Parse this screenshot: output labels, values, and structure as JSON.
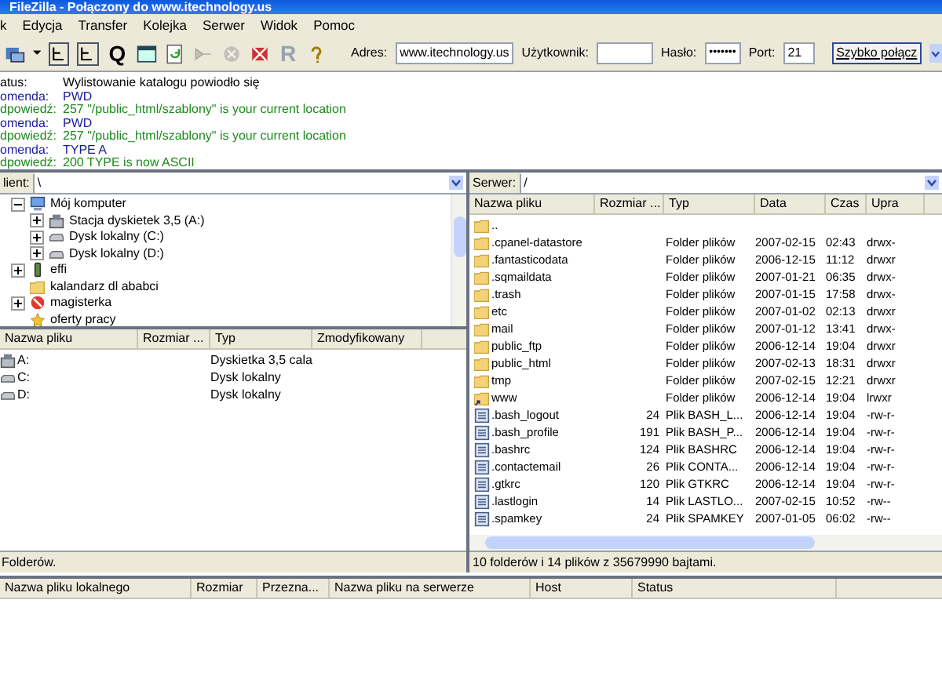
{
  "window": {
    "title": "FileZilla - Połączony do www.itechnology.us"
  },
  "menu": [
    "k",
    "Edycja",
    "Transfer",
    "Kolejka",
    "Serwer",
    "Widok",
    "Pomoc"
  ],
  "toolbar": [
    {
      "kind": "sitemanager",
      "disabled": false
    },
    {
      "kind": "dropdown",
      "disabled": false
    },
    {
      "kind": "tree",
      "disabled": false
    },
    {
      "kind": "tree",
      "disabled": false
    },
    {
      "kind": "letter",
      "glyph": "Q",
      "disabled": false
    },
    {
      "kind": "window",
      "disabled": false
    },
    {
      "kind": "refresh",
      "disabled": false
    },
    {
      "kind": "process",
      "disabled": true
    },
    {
      "kind": "cancel",
      "disabled": true
    },
    {
      "kind": "disconnect",
      "disabled": false
    },
    {
      "kind": "letter",
      "glyph": "R",
      "disabled": true
    },
    {
      "kind": "help",
      "disabled": false
    }
  ],
  "quickconnect": {
    "address_label": "Adres:",
    "address": "www.itechnology.us",
    "user_label": "Użytkownik:",
    "password_label": "Hasło:",
    "password": "•••••••",
    "port_label": "Port:",
    "port": "21",
    "button": "Szybko połącz"
  },
  "log": [
    {
      "kind": "status",
      "label": "atus:",
      "text": "Wylistowanie katalogu powiodło się"
    },
    {
      "kind": "command",
      "label": "omenda:",
      "text": "PWD"
    },
    {
      "kind": "response",
      "label": "dpowiedź:",
      "text": "257 \"/public_html/szablony\" is your current location"
    },
    {
      "kind": "command",
      "label": "omenda:",
      "text": "PWD"
    },
    {
      "kind": "response",
      "label": "dpowiedź:",
      "text": "257 \"/public_html/szablony\" is your current location"
    },
    {
      "kind": "command",
      "label": "omenda:",
      "text": "TYPE A"
    },
    {
      "kind": "response",
      "label": "dpowiedź:",
      "text": "200 TYPE is now ASCII"
    }
  ],
  "local": {
    "path_label": "lient:",
    "path": "\\",
    "tree": [
      {
        "label": "Mój komputer",
        "kind": "computer",
        "expanded": true,
        "children": [
          {
            "label": "Stacja dyskietek 3,5 (A:)",
            "kind": "floppy",
            "expanded": false
          },
          {
            "label": "Dysk lokalny (C:)",
            "kind": "drive",
            "expanded": false
          },
          {
            "label": "Dysk lokalny (D:)",
            "kind": "drive",
            "expanded": false
          }
        ]
      },
      {
        "label": "effi",
        "kind": "device",
        "expanded": false
      },
      {
        "label": "kalandarz dl ababci",
        "kind": "folder"
      },
      {
        "label": "magisterka",
        "kind": "blocked",
        "expanded": false
      },
      {
        "label": "oferty pracy",
        "kind": "star"
      }
    ],
    "columns": [
      "Nazwa pliku",
      "Rozmiar ...",
      "Typ",
      "Zmodyfikowany"
    ],
    "rows": [
      {
        "name": "A:",
        "type": "Dyskietka 3,5 cala",
        "kind": "floppy"
      },
      {
        "name": "C:",
        "type": "Dysk lokalny",
        "kind": "drive"
      },
      {
        "name": "D:",
        "type": "Dysk lokalny",
        "kind": "drive"
      }
    ],
    "status": "Folderów."
  },
  "remote": {
    "path_label": "Serwer:",
    "path": "/",
    "columns": [
      "Nazwa pliku",
      "Rozmiar ...",
      "Typ",
      "Data",
      "Czas",
      "Upra"
    ],
    "rows": [
      {
        "kind": "folder",
        "name": ".."
      },
      {
        "kind": "folder",
        "name": ".cpanel-datastore",
        "type": "Folder plików",
        "date": "2007-02-15",
        "time": "02:43",
        "perms": "drwx-"
      },
      {
        "kind": "folder",
        "name": ".fantasticodata",
        "type": "Folder plików",
        "date": "2006-12-15",
        "time": "11:12",
        "perms": "drwxr"
      },
      {
        "kind": "folder",
        "name": ".sqmaildata",
        "type": "Folder plików",
        "date": "2007-01-21",
        "time": "06:35",
        "perms": "drwx-"
      },
      {
        "kind": "folder",
        "name": ".trash",
        "type": "Folder plików",
        "date": "2007-01-15",
        "time": "17:58",
        "perms": "drwx-"
      },
      {
        "kind": "folder",
        "name": "etc",
        "type": "Folder plików",
        "date": "2007-01-02",
        "time": "02:13",
        "perms": "drwxr"
      },
      {
        "kind": "folder",
        "name": "mail",
        "type": "Folder plików",
        "date": "2007-01-12",
        "time": "13:41",
        "perms": "drwx-"
      },
      {
        "kind": "folder",
        "name": "public_ftp",
        "type": "Folder plików",
        "date": "2006-12-14",
        "time": "19:04",
        "perms": "drwxr"
      },
      {
        "kind": "folder",
        "name": "public_html",
        "type": "Folder plików",
        "date": "2007-02-13",
        "time": "18:31",
        "perms": "drwxr"
      },
      {
        "kind": "folder",
        "name": "tmp",
        "type": "Folder plików",
        "date": "2007-02-15",
        "time": "12:21",
        "perms": "drwxr"
      },
      {
        "kind": "link",
        "name": "www",
        "type": "Folder plików",
        "date": "2006-12-14",
        "time": "19:04",
        "perms": "lrwxr"
      },
      {
        "kind": "file",
        "name": ".bash_logout",
        "size": "24",
        "type": "Plik BASH_L...",
        "date": "2006-12-14",
        "time": "19:04",
        "perms": "-rw-r-"
      },
      {
        "kind": "file",
        "name": ".bash_profile",
        "size": "191",
        "type": "Plik BASH_P...",
        "date": "2006-12-14",
        "time": "19:04",
        "perms": "-rw-r-"
      },
      {
        "kind": "file",
        "name": ".bashrc",
        "size": "124",
        "type": "Plik BASHRC",
        "date": "2006-12-14",
        "time": "19:04",
        "perms": "-rw-r-"
      },
      {
        "kind": "file",
        "name": ".contactemail",
        "size": "26",
        "type": "Plik CONTA...",
        "date": "2006-12-14",
        "time": "19:04",
        "perms": "-rw-r-"
      },
      {
        "kind": "file",
        "name": ".gtkrc",
        "size": "120",
        "type": "Plik GTKRC",
        "date": "2006-12-14",
        "time": "19:04",
        "perms": "-rw-r-"
      },
      {
        "kind": "file",
        "name": ".lastlogin",
        "size": "14",
        "type": "Plik LASTLO...",
        "date": "2007-02-15",
        "time": "10:52",
        "perms": "-rw--"
      },
      {
        "kind": "file",
        "name": ".spamkey",
        "size": "24",
        "type": "Plik SPAMKEY",
        "date": "2007-01-05",
        "time": "06:02",
        "perms": "-rw--"
      }
    ],
    "status": "10 folderów i 14 plików z 35679990 bajtami."
  },
  "queue": {
    "columns": [
      "Nazwa pliku lokalnego",
      "Rozmiar",
      "Przezna...",
      "Nazwa pliku na serwerze",
      "Host",
      "Status"
    ]
  }
}
